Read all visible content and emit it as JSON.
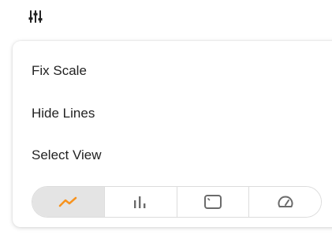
{
  "toolbar": {
    "settings_icon": "sliders-icon"
  },
  "menu": {
    "items": [
      {
        "label": "Fix Scale"
      },
      {
        "label": "Hide Lines"
      },
      {
        "label": "Select View"
      }
    ]
  },
  "view_selector": {
    "options": [
      {
        "icon": "line-chart-icon",
        "selected": true
      },
      {
        "icon": "bar-chart-icon",
        "selected": false
      },
      {
        "icon": "area-chart-icon",
        "selected": false
      },
      {
        "icon": "gauge-icon",
        "selected": false
      }
    ]
  },
  "colors": {
    "accent": "#f7931e",
    "icon_gray": "#6b6b6b",
    "selected_bg": "#e4e4e4"
  }
}
